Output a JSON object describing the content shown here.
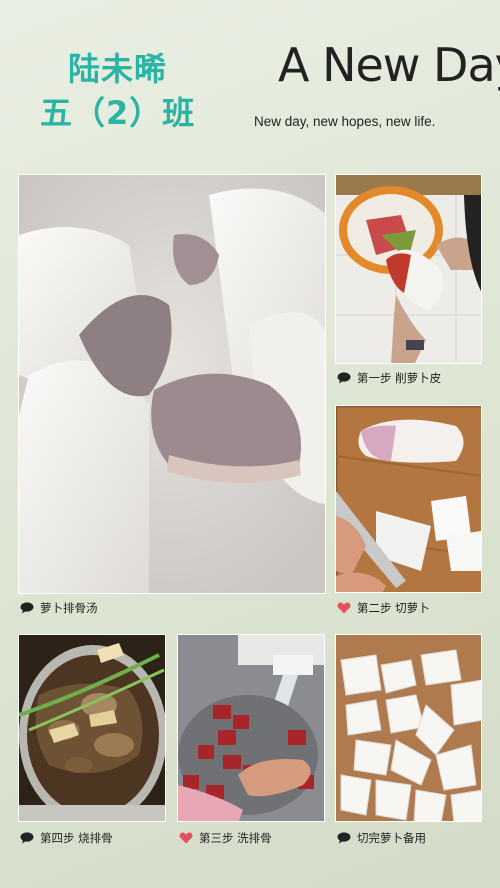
{
  "header": {
    "name": "陆未晞",
    "class_name": "五（2）班",
    "title": "A New Day",
    "motto": "New day, new hopes, new life."
  },
  "photos": [
    {
      "caption": "萝卜排骨汤",
      "icon": "comment-icon"
    },
    {
      "caption": "第一步 削萝卜皮",
      "icon": "comment-icon"
    },
    {
      "caption": "第二步 切萝卜",
      "icon": "heart-icon"
    },
    {
      "caption": "第四步 烧排骨",
      "icon": "comment-icon"
    },
    {
      "caption": "第三步 洗排骨",
      "icon": "heart-icon"
    },
    {
      "caption": "切完萝卜备用",
      "icon": "comment-icon"
    }
  ],
  "colors": {
    "accent": "#2bb3a3",
    "heart": "#e0525e",
    "text": "#222222"
  }
}
